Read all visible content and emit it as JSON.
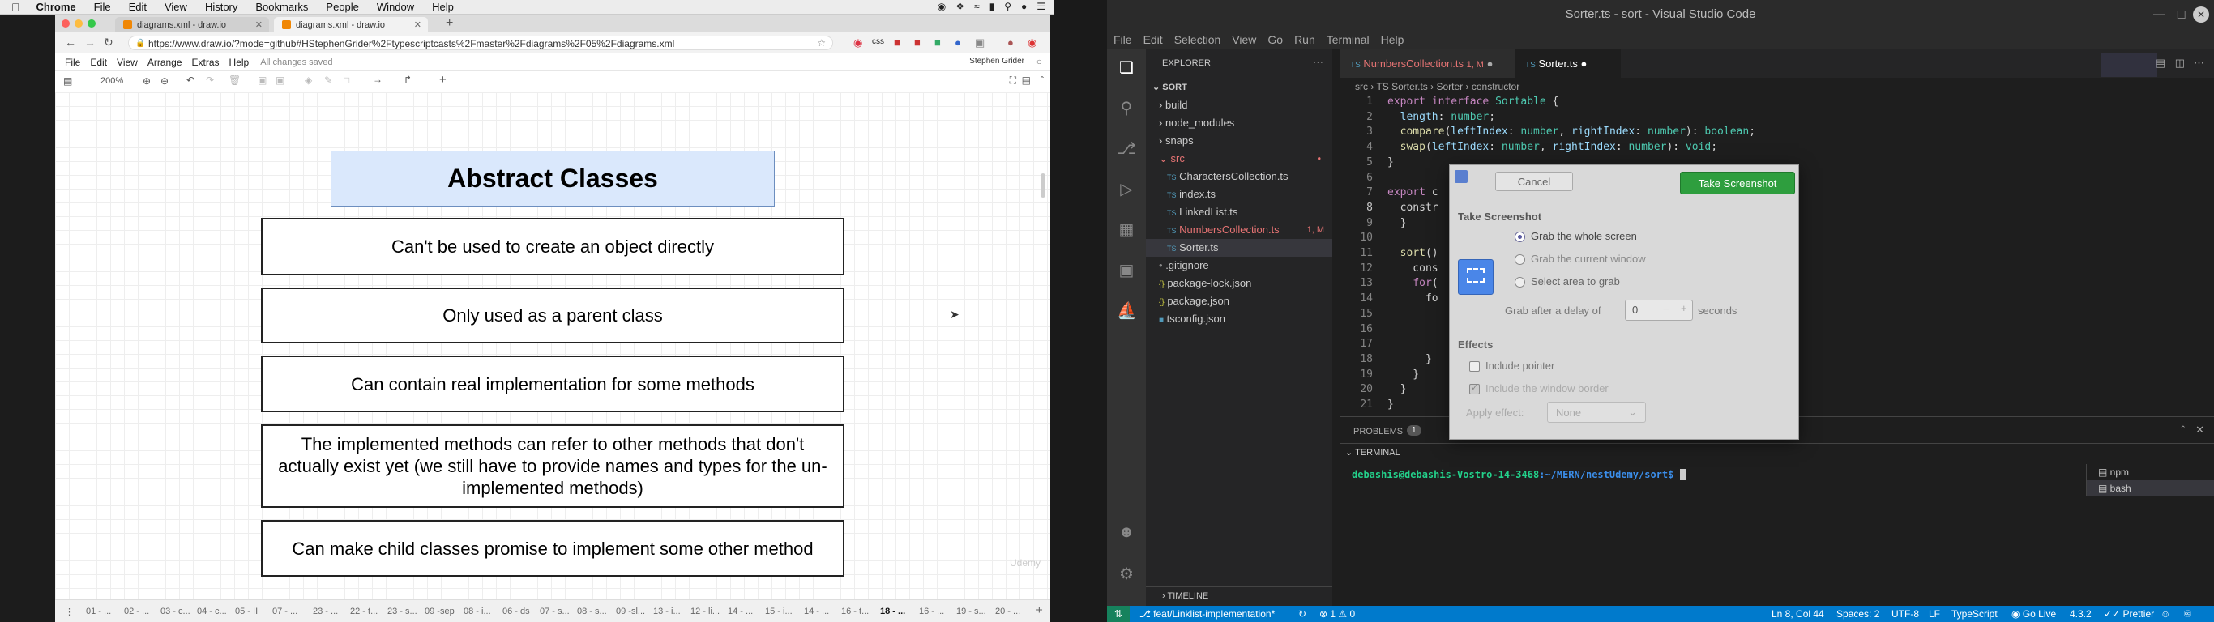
{
  "macmenu": {
    "items": [
      "Chrome",
      "File",
      "Edit",
      "View",
      "History",
      "Bookmarks",
      "People",
      "Window",
      "Help"
    ]
  },
  "chrome": {
    "tabs": [
      {
        "title": "diagrams.xml - draw.io"
      },
      {
        "title": "diagrams.xml - draw.io"
      }
    ],
    "url": "https://www.draw.io/?mode=github#HStephenGrider%2Ftypescriptcasts%2Fmaster%2Fdiagrams%2F05%2Fdiagrams.xml",
    "user": "Stephen Grider"
  },
  "drawio": {
    "menus": [
      "File",
      "Edit",
      "View",
      "Arrange",
      "Extras",
      "Help"
    ],
    "saved": "All changes saved",
    "zoom": "200%",
    "title": "Abstract Classes",
    "boxes": [
      "Can't be used to create an object directly",
      "Only used as a parent class",
      "Can contain real implementation for some methods",
      "The implemented methods can refer to other methods that don't actually exist yet (we still have to provide names and types for the un-implemented methods)",
      "Can make child classes promise to implement some other method"
    ],
    "watermark": "Udemy",
    "pages": [
      "01 - ...",
      "02 - ...",
      "03 - c...",
      "04 - c...",
      "05 - II",
      "07 - ...",
      "23 - ...",
      "22 - t...",
      "23 - s...",
      "09 -sep",
      "08 - i...",
      "06 - ds",
      "07 - s...",
      "08 - s...",
      "09 -sl...",
      "13 - i...",
      "12 - li...",
      "14 - ...",
      "15 - i...",
      "14 - ...",
      "16 - t...",
      "18 - ...",
      "16 - ...",
      "19 - s...",
      "20 - ..."
    ]
  },
  "vscode": {
    "title": "Sorter.ts - sort - Visual Studio Code",
    "menus": [
      "File",
      "Edit",
      "Selection",
      "View",
      "Go",
      "Run",
      "Terminal",
      "Help"
    ],
    "explorer_header": "EXPLORER",
    "project": "SORT",
    "tree": [
      {
        "name": "build",
        "type": "folder"
      },
      {
        "name": "node_modules",
        "type": "folder"
      },
      {
        "name": "snaps",
        "type": "folder"
      },
      {
        "name": "src",
        "type": "folder-open"
      },
      {
        "name": "CharactersCollection.ts",
        "type": "ts"
      },
      {
        "name": "index.ts",
        "type": "ts"
      },
      {
        "name": "LinkedList.ts",
        "type": "ts"
      },
      {
        "name": "NumbersCollection.ts",
        "type": "ts-mod",
        "badge": "1, M"
      },
      {
        "name": "Sorter.ts",
        "type": "ts"
      },
      {
        "name": ".gitignore",
        "type": "file"
      },
      {
        "name": "package-lock.json",
        "type": "json"
      },
      {
        "name": "package.json",
        "type": "json"
      },
      {
        "name": "tsconfig.json",
        "type": "json"
      }
    ],
    "tabs": [
      {
        "name": "NumbersCollection.ts",
        "badge": "1, M"
      },
      {
        "name": "Sorter.ts"
      }
    ],
    "breadcrumb": [
      "src",
      "TS Sorter.ts",
      "Sorter",
      "constructor"
    ],
    "lines": [
      "export interface Sortable {",
      "  length: number;",
      "  compare(leftIndex: number, rightIndex: number): boolean;",
      "  swap(leftIndex: number, rightIndex: number): void;",
      "}",
      "",
      "export c",
      "  constr",
      "  }",
      "",
      "  sort()",
      "    cons",
      "    for(",
      "      fo",
      "",
      "",
      "",
      "      }",
      "    }",
      "  }",
      "}"
    ],
    "panel_tabs": {
      "problems": "PROBLEMS",
      "problems_count": "1",
      "terminal": "TERMINAL"
    },
    "terminal_prompt": "debashis@debashis-Vostro-14-3468",
    "terminal_path": ":~/MERN/nestUdemy/sort$",
    "terminal_list": [
      "npm",
      "bash"
    ],
    "timeline": "TIMELINE",
    "status": {
      "branch": "feat/Linklist-implementation*",
      "errors": "1",
      "warnings": "0",
      "position": "Ln 8, Col 44",
      "spaces": "Spaces: 2",
      "encoding": "UTF-8",
      "eol": "LF",
      "lang": "TypeScript",
      "golive": "Go Live",
      "version": "4.3.2",
      "prettier": "Prettier"
    }
  },
  "screenshot_dialog": {
    "cancel": "Cancel",
    "take": "Take Screenshot",
    "heading": "Take Screenshot",
    "options": [
      "Grab the whole screen",
      "Grab the current window",
      "Select area to grab"
    ],
    "delay_label": "Grab after a delay of",
    "delay_value": "0",
    "delay_unit": "seconds",
    "effects": "Effects",
    "include_pointer": "Include pointer",
    "include_border": "Include the window border",
    "apply_effect_label": "Apply effect:",
    "apply_effect_value": "None"
  }
}
